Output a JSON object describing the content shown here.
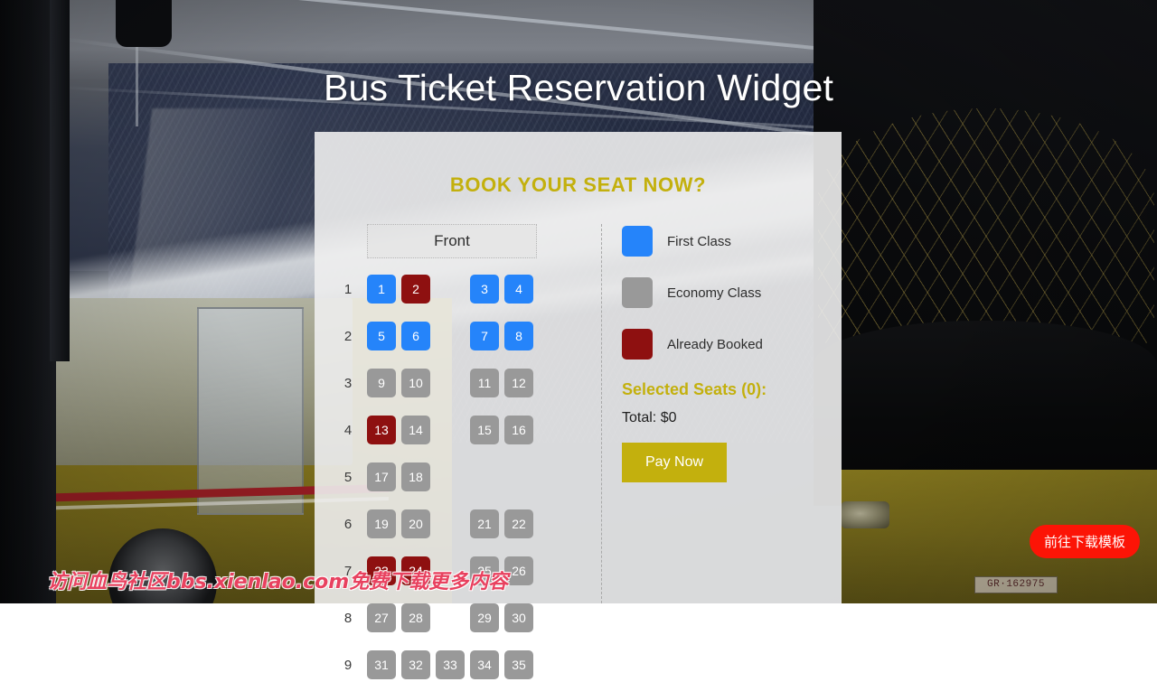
{
  "page": {
    "title": "Bus Ticket Reservation Widget"
  },
  "card": {
    "heading": "BOOK YOUR SEAT NOW?",
    "front_label": "Front"
  },
  "legend": {
    "items": [
      {
        "label": "First Class",
        "swatch": "first",
        "color": "#2584fa"
      },
      {
        "label": "Economy Class",
        "swatch": "economy",
        "color": "#999999"
      },
      {
        "label": "Already Booked",
        "swatch": "booked",
        "color": "#8e1010"
      }
    ]
  },
  "summary": {
    "selected_seats_title": "Selected Seats (0):",
    "selected_count": 0,
    "total_label": "Total: $0",
    "total_value": 0,
    "currency": "$",
    "pay_button_label": "Pay Now"
  },
  "seat_map": {
    "row_numbers": [
      "1",
      "2",
      "3",
      "4",
      "5",
      "6",
      "7",
      "8",
      "9"
    ],
    "rows": [
      {
        "row": "1",
        "left": [
          {
            "number": "1",
            "type": "first"
          },
          {
            "number": "2",
            "type": "booked"
          }
        ],
        "aisle": null,
        "right": [
          {
            "number": "3",
            "type": "first"
          },
          {
            "number": "4",
            "type": "first"
          }
        ]
      },
      {
        "row": "2",
        "left": [
          {
            "number": "5",
            "type": "first"
          },
          {
            "number": "6",
            "type": "first"
          }
        ],
        "aisle": null,
        "right": [
          {
            "number": "7",
            "type": "first"
          },
          {
            "number": "8",
            "type": "first"
          }
        ]
      },
      {
        "row": "3",
        "left": [
          {
            "number": "9",
            "type": "economy"
          },
          {
            "number": "10",
            "type": "economy"
          }
        ],
        "aisle": null,
        "right": [
          {
            "number": "11",
            "type": "economy"
          },
          {
            "number": "12",
            "type": "economy"
          }
        ]
      },
      {
        "row": "4",
        "left": [
          {
            "number": "13",
            "type": "booked"
          },
          {
            "number": "14",
            "type": "economy"
          }
        ],
        "aisle": null,
        "right": [
          {
            "number": "15",
            "type": "economy"
          },
          {
            "number": "16",
            "type": "economy"
          }
        ]
      },
      {
        "row": "5",
        "left": [
          {
            "number": "17",
            "type": "economy"
          },
          {
            "number": "18",
            "type": "economy"
          }
        ],
        "aisle": null,
        "right": []
      },
      {
        "row": "6",
        "left": [
          {
            "number": "19",
            "type": "economy"
          },
          {
            "number": "20",
            "type": "economy"
          }
        ],
        "aisle": null,
        "right": [
          {
            "number": "21",
            "type": "economy"
          },
          {
            "number": "22",
            "type": "economy"
          }
        ]
      },
      {
        "row": "7",
        "left": [
          {
            "number": "23",
            "type": "booked"
          },
          {
            "number": "24",
            "type": "booked"
          }
        ],
        "aisle": null,
        "right": [
          {
            "number": "25",
            "type": "economy"
          },
          {
            "number": "26",
            "type": "economy"
          }
        ]
      },
      {
        "row": "8",
        "left": [
          {
            "number": "27",
            "type": "economy"
          },
          {
            "number": "28",
            "type": "economy"
          }
        ],
        "aisle": null,
        "right": [
          {
            "number": "29",
            "type": "economy"
          },
          {
            "number": "30",
            "type": "economy"
          }
        ]
      },
      {
        "row": "9",
        "left": [
          {
            "number": "31",
            "type": "economy"
          },
          {
            "number": "32",
            "type": "economy"
          }
        ],
        "aisle": {
          "number": "33",
          "type": "economy"
        },
        "right": [
          {
            "number": "34",
            "type": "economy"
          },
          {
            "number": "35",
            "type": "economy"
          }
        ]
      }
    ]
  },
  "overlays": {
    "watermark_text": "访问血鸟社区bbs.xienlao.com免费下载更多内容",
    "download_button_label": "前往下载模板",
    "license_plate": "GR·162975"
  },
  "colors": {
    "accent_gold": "#c3b00d",
    "first_class": "#2584fa",
    "economy": "#999999",
    "booked": "#8e1010",
    "card_background": "#eeeeee",
    "download_button": "#fc1406",
    "watermark": "#e8415f"
  }
}
